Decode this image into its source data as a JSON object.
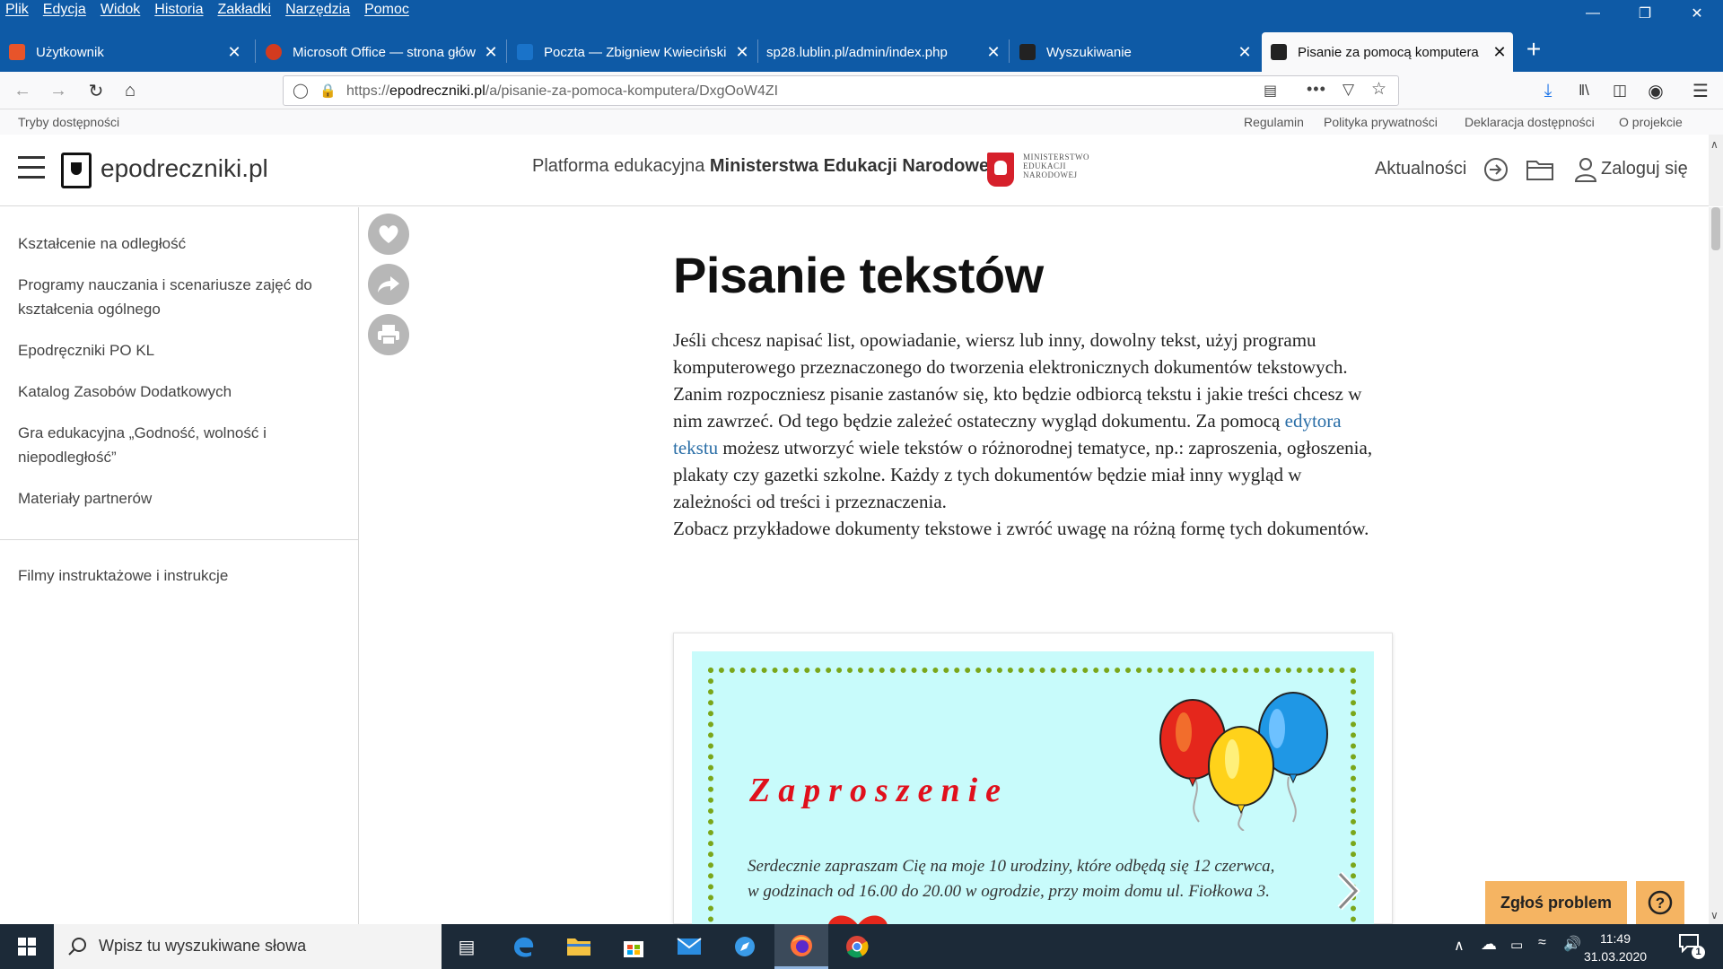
{
  "menu": [
    "Plik",
    "Edycja",
    "Widok",
    "Historia",
    "Zakładki",
    "Narzędzia",
    "Pomoc"
  ],
  "tabs": [
    {
      "label": "Użytkownik",
      "favicon_color": "#e8542a"
    },
    {
      "label": "Microsoft Office — strona głów",
      "favicon_color": "#d33b1f"
    },
    {
      "label": "Poczta — Zbigniew Kwieciński",
      "favicon_color": "#1a73c9"
    },
    {
      "label": "sp28.lublin.pl/admin/index.php",
      "favicon_color": ""
    },
    {
      "label": "Wyszukiwanie",
      "favicon_color": "#222"
    },
    {
      "label": "Pisanie za pomocą komputera",
      "favicon_color": "#222"
    }
  ],
  "url": {
    "prefix": "https://",
    "host": "epodreczniki.pl",
    "path": "/a/pisanie-za-pomoca-komputera/DxgOoW4ZI"
  },
  "bookbar": {
    "left": "Tryby dostępności",
    "links": [
      "Regulamin",
      "Polityka prywatności",
      "Deklaracja dostępności",
      "O projekcie"
    ]
  },
  "site": {
    "logo": "epodreczniki.pl",
    "platform_prefix": "Platforma edukacyjna ",
    "platform_bold": "Ministerstwa Edukacji Narodowej",
    "men_lines": [
      "MINISTERSTWO",
      "EDUKACJI",
      "NARODOWEJ"
    ],
    "news": "Aktualności",
    "login": "Zaloguj się"
  },
  "sidebar": {
    "items": [
      "Kształcenie na odległość",
      "Programy nauczania i scenariusze zajęć do kształcenia ogólnego",
      "Epodręczniki PO KL",
      "Katalog Zasobów Dodatkowych",
      "Gra edukacyjna „Godność, wolność i niepodległość”",
      "Materiały partnerów"
    ],
    "bottom_item": "Filmy instruktażowe i instrukcje"
  },
  "content": {
    "title": "Pisanie tekstów",
    "p1": "Jeśli chcesz napisać list, opowiadanie, wiersz lub inny, dowolny tekst, użyj programu komputerowego przeznaczonego do tworzenia elektronicznych dokumentów tekstowych.",
    "p2_before": "Zanim rozpoczniesz pisanie zastanów się, kto będzie odbiorcą tekstu i jakie treści chcesz w nim zawrzeć. Od tego będzie zależeć ostateczny wygląd dokumentu. Za pomocą ",
    "p2_link": "edytora tekstu",
    "p2_after": " możesz utworzyć wiele tekstów o różnorodnej tematyce, np.: zaproszenia, ogłoszenia, plakaty czy gazetki szkolne. Każdy z tych dokumentów będzie miał inny wygląd w zależności od treści i przeznaczenia.",
    "p3": "Zobacz przykładowe dokumenty tekstowe i zwróć uwagę na różną formę tych dokumentów."
  },
  "invitation": {
    "title": "Zaproszenie",
    "text_line1": "Serdecznie zapraszam Cię na moje 10 urodziny, które odbędą się 12 czerwca,",
    "text_line2": "w godzinach od 16.00 do 20.00 w ogrodzie, przy moim domu ul. Fiołkowa 3."
  },
  "floating": {
    "report": "Zgłoś problem",
    "help": "?"
  },
  "taskbar": {
    "search_placeholder": "Wpisz tu wyszukiwane słowa",
    "time": "11:49",
    "date": "31.03.2020",
    "notification_count": "1"
  },
  "colors": {
    "browser_accent": "#0e5aa6",
    "link": "#2a6ea7",
    "report_button": "#f5b462",
    "invitation_bg": "#c8fbfb",
    "invitation_title": "#e0101c"
  }
}
